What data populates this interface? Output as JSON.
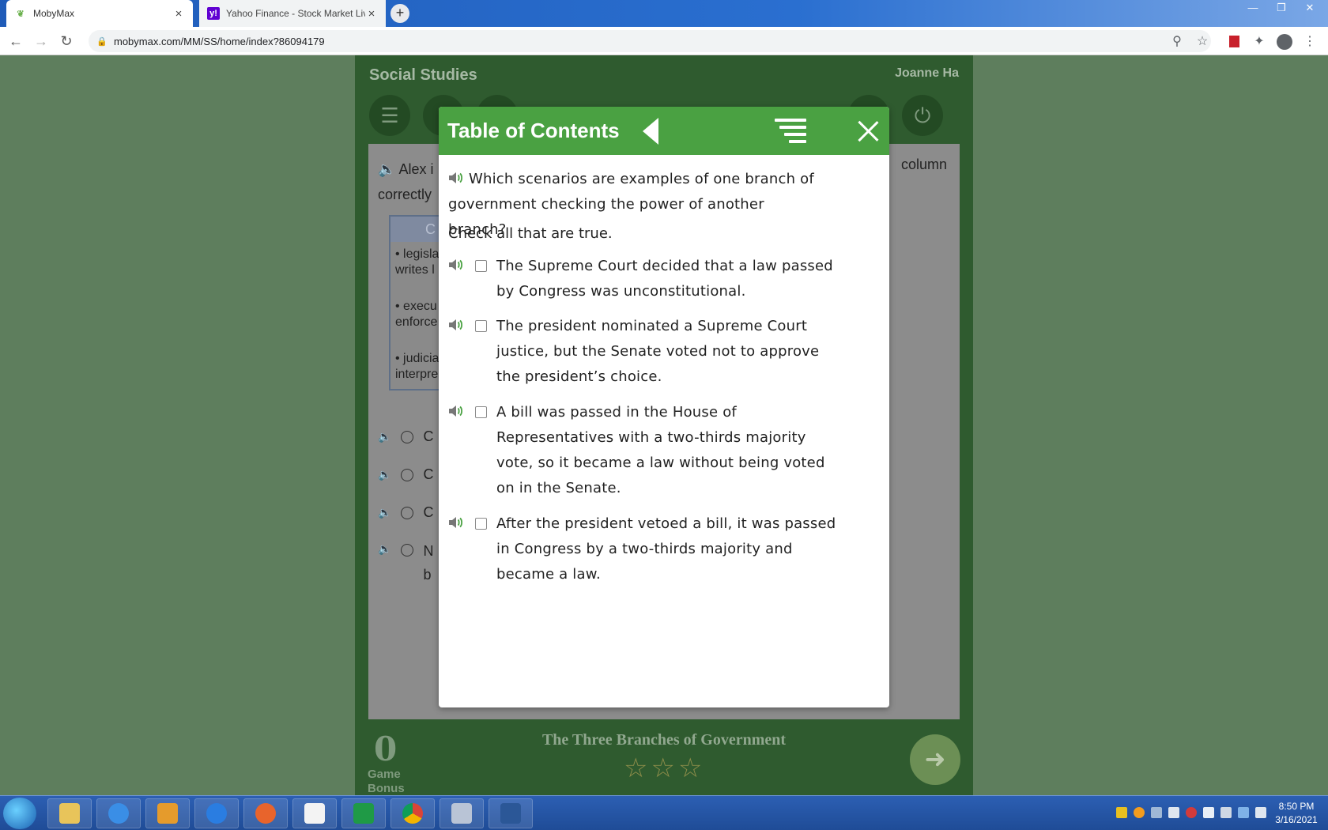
{
  "browser": {
    "tabs": [
      {
        "title": "MobyMax",
        "favicon": "mobymax-leaf-icon",
        "active": true
      },
      {
        "title": "Yahoo Finance - Stock Market Liv",
        "favicon": "yahoo-icon",
        "active": false
      }
    ],
    "url": "mobymax.com/MM/SS/home/index?86094179"
  },
  "app": {
    "subject": "Social Studies",
    "user": "Joanne Ha",
    "background_question_start": "Alex i",
    "background_question_end": "column",
    "background_question_line2": "correctly",
    "background_box": {
      "header": "C",
      "items": [
        "• legisla\nwrites l",
        "• execu\nenforce",
        "• judicia\ninterpre"
      ]
    },
    "background_options": [
      "C",
      "C",
      "C",
      "N\nb"
    ],
    "footer": {
      "score": "0",
      "score_label_1": "Game",
      "score_label_2": "Bonus",
      "lesson_title": "The Three Branches of Government"
    }
  },
  "modal": {
    "title": "Table of Contents",
    "question": "Which scenarios are examples of one branch of government checking the power of another branch?",
    "instruction": "Check all that are true.",
    "options": [
      {
        "text": "The Supreme Court decided that a law passed by Congress was unconstitutional.",
        "checked": false
      },
      {
        "text": "The president nominated a Supreme Court justice, but the Senate voted not to approve the president’s choice.",
        "checked": false
      },
      {
        "text": "A bill was passed in the House of Representatives with a two-thirds majority vote, so it became a law without being voted on in the Senate.",
        "checked": false
      },
      {
        "text": "After the president vetoed a bill, it was passed in Congress by a two-thirds majority and became a law.",
        "checked": false
      }
    ]
  },
  "taskbar": {
    "time": "8:50 PM",
    "date": "3/16/2021"
  },
  "colors": {
    "modal_header": "#4aa142",
    "app_background": "#2f5b2f"
  }
}
